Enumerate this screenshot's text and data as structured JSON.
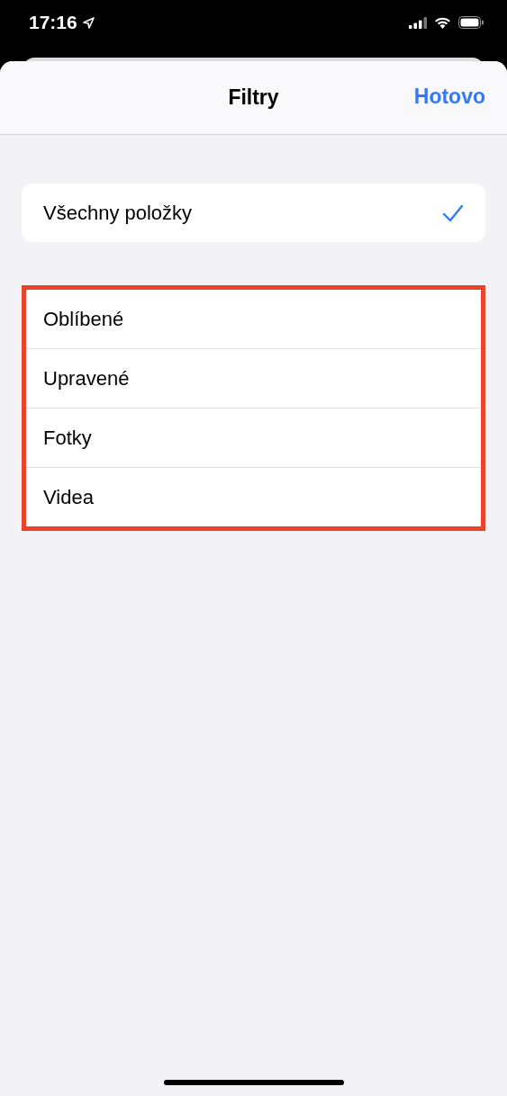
{
  "status_bar": {
    "time": "17:16"
  },
  "nav": {
    "title": "Filtry",
    "done": "Hotovo"
  },
  "groups": [
    {
      "highlighted": false,
      "items": [
        {
          "label": "Všechny položky",
          "selected": true
        }
      ]
    },
    {
      "highlighted": true,
      "items": [
        {
          "label": "Oblíbené",
          "selected": false
        },
        {
          "label": "Upravené",
          "selected": false
        },
        {
          "label": "Fotky",
          "selected": false
        },
        {
          "label": "Videa",
          "selected": false
        }
      ]
    }
  ]
}
